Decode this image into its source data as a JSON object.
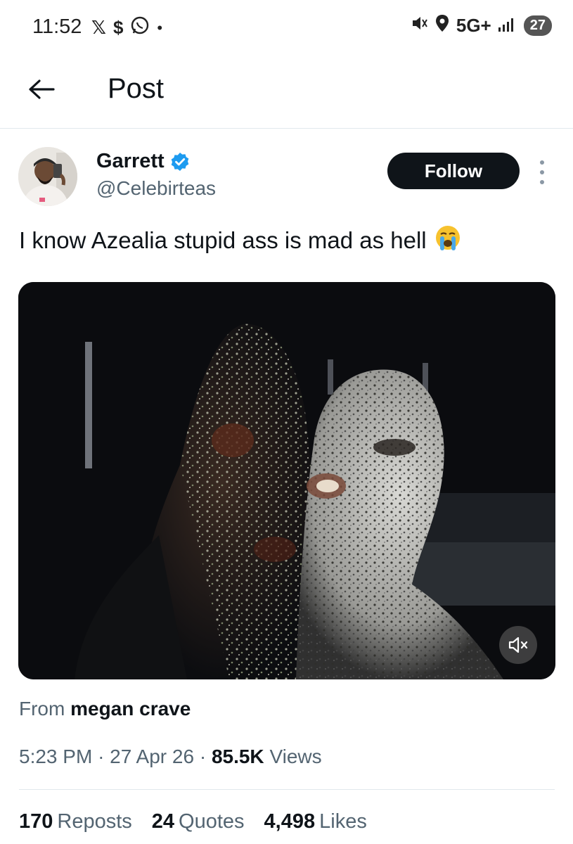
{
  "status_bar": {
    "time": "11:52",
    "left_icons": [
      "x-logo-icon",
      "dollar-icon",
      "whatsapp-icon",
      "dot-icon"
    ],
    "x_glyph": "𝕏",
    "dollar_glyph": "$",
    "dot_glyph": "•",
    "network": "5G+",
    "battery": "27"
  },
  "header": {
    "title": "Post"
  },
  "author": {
    "name": "Garrett",
    "handle": "@Celebirteas",
    "verified": true,
    "follow_label": "Follow"
  },
  "tweet": {
    "text": "I know Azealia stupid ass is mad as hell",
    "emoji": "😭"
  },
  "media": {
    "type": "video",
    "muted": true
  },
  "source": {
    "prefix": "From",
    "name": "megan crave"
  },
  "meta": {
    "time": "5:23 PM",
    "separator": "·",
    "date": "27 Apr 26",
    "views_count": "85.5K",
    "views_label": "Views"
  },
  "stats": {
    "reposts_count": "170",
    "reposts_label": "Reposts",
    "quotes_count": "24",
    "quotes_label": "Quotes",
    "likes_count": "4,498",
    "likes_label": "Likes"
  },
  "colors": {
    "verified_blue": "#1d9bf0",
    "text_primary": "#0f1419",
    "text_secondary": "#536471",
    "follow_bg": "#0f1419"
  }
}
